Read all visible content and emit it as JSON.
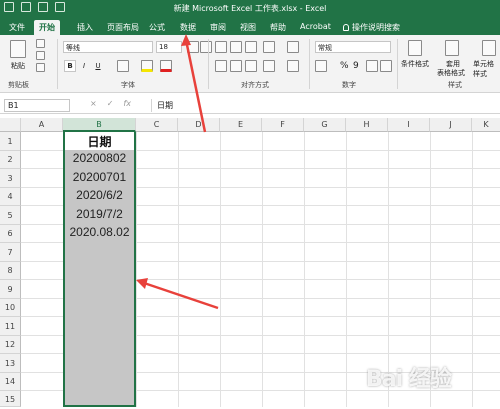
{
  "window": {
    "title": "新建 Microsoft Excel 工作表.xlsx  -  Excel",
    "brand_color": "#217346"
  },
  "ribbon_tabs": [
    "文件",
    "开始",
    "插入",
    "页面布局",
    "公式",
    "数据",
    "审阅",
    "视图",
    "帮助",
    "Acrobat",
    "操作说明搜索"
  ],
  "ribbon": {
    "font_name": "等线",
    "font_size": "18",
    "number_format": "常规",
    "bold": "B",
    "italic": "I",
    "underline": "U",
    "percent": "%",
    "comma": "9",
    "groups": {
      "clipboard": "剪贴板",
      "font": "字体",
      "alignment": "对齐方式",
      "number": "数字",
      "styles": "样式"
    },
    "style_buttons": {
      "conditional": "条件格式",
      "table": "套用",
      "table_line2": "表格格式",
      "cell_styles": "单元格样式"
    },
    "paste": "粘贴"
  },
  "formula_bar": {
    "name_box": "B1",
    "cancel": "×",
    "enter": "✓",
    "fx": "fx",
    "content": "日期"
  },
  "columns": [
    "A",
    "B",
    "C",
    "D",
    "E",
    "F",
    "G",
    "H",
    "I",
    "J",
    "K"
  ],
  "rows": [
    "1",
    "2",
    "3",
    "4",
    "5",
    "6",
    "7",
    "8",
    "9",
    "10",
    "11",
    "12",
    "13",
    "14",
    "15"
  ],
  "cells": {
    "b1": "日期",
    "b2": "20200802",
    "b3": "20200701",
    "b4": "2020/6/2",
    "b5": "2019/7/2",
    "b6": "2020.08.02"
  },
  "selection": {
    "column": "B",
    "fill": "#c6c6c6",
    "border": "#217346"
  },
  "annotation_color": "#e8413b",
  "watermark": "Bai 经验"
}
